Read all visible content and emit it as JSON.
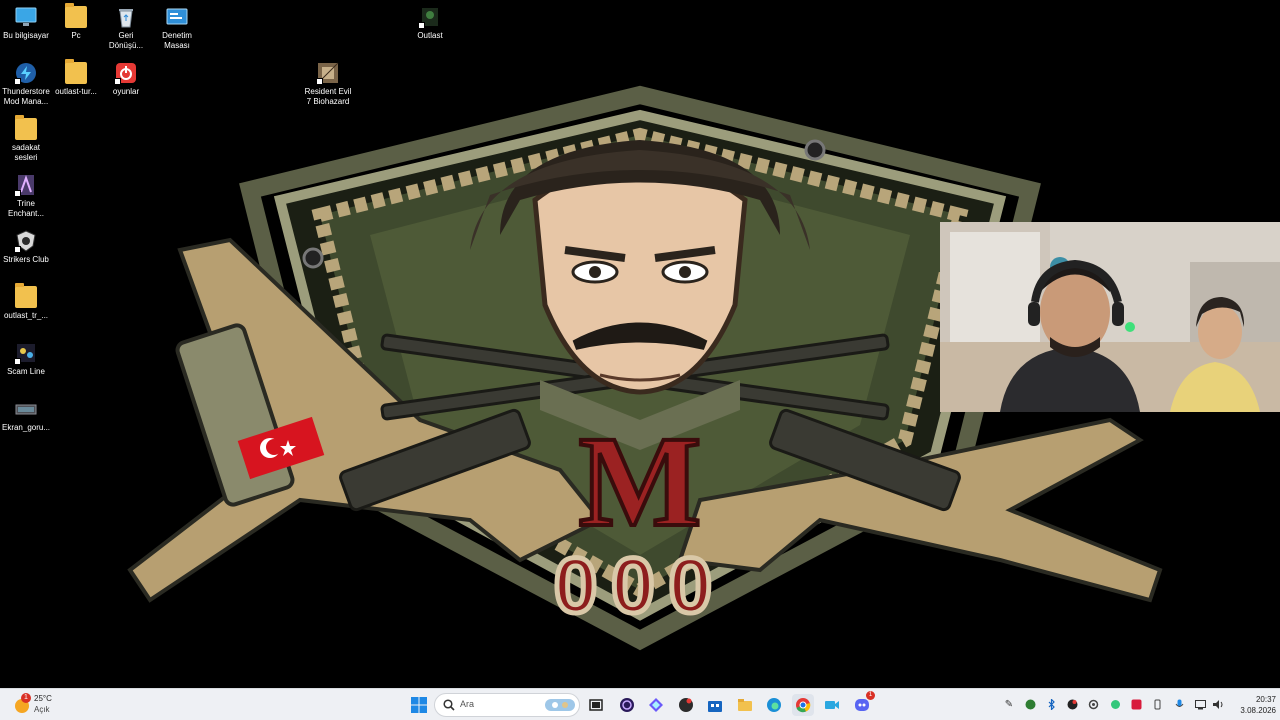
{
  "desktop": {
    "icons": [
      {
        "label": "Bu bilgisayar",
        "icon": "monitor-icon"
      },
      {
        "label": "Pc",
        "icon": "folder-icon"
      },
      {
        "label": "Geri\nDönüşü...",
        "icon": "recycle-bin-icon"
      },
      {
        "label": "Denetim\nMasası",
        "icon": "control-panel-icon"
      },
      {
        "label": "Outlast",
        "icon": "game-shortcut-icon"
      },
      {
        "label": "Thunderstore\nMod Mana...",
        "icon": "thunderstore-icon"
      },
      {
        "label": "outlast-tur...",
        "icon": "folder-icon"
      },
      {
        "label": "oyunlar",
        "icon": "power-app-icon"
      },
      {
        "label": "Resident Evil\n7 Biohazard",
        "icon": "resident-evil-icon"
      },
      {
        "label": "sadakat\nsesleri",
        "icon": "folder-icon"
      },
      {
        "label": "Trine\nEnchant...",
        "icon": "trine-icon"
      },
      {
        "label": "Strikers Club",
        "icon": "strikers-club-icon"
      },
      {
        "label": "outlast_tr_...",
        "icon": "folder-icon"
      },
      {
        "label": "Scam Line",
        "icon": "scam-line-icon"
      },
      {
        "label": "Ekran_goru...",
        "icon": "screenshot-file-icon"
      }
    ]
  },
  "wallpaper": {
    "emblem_letter": "M",
    "emblem_number": "000"
  },
  "taskbar": {
    "weather": {
      "temp": "25°C",
      "condition": "Açık",
      "badge": "1"
    },
    "search_placeholder": "Ara",
    "discord_badge": "1",
    "clock": {
      "time": "20:37",
      "date": "3.08.2026"
    },
    "colors": {
      "taskbar_bg": "#eef0f4",
      "windows_blue": "#1e88e5",
      "badge_red": "#d93025"
    }
  }
}
